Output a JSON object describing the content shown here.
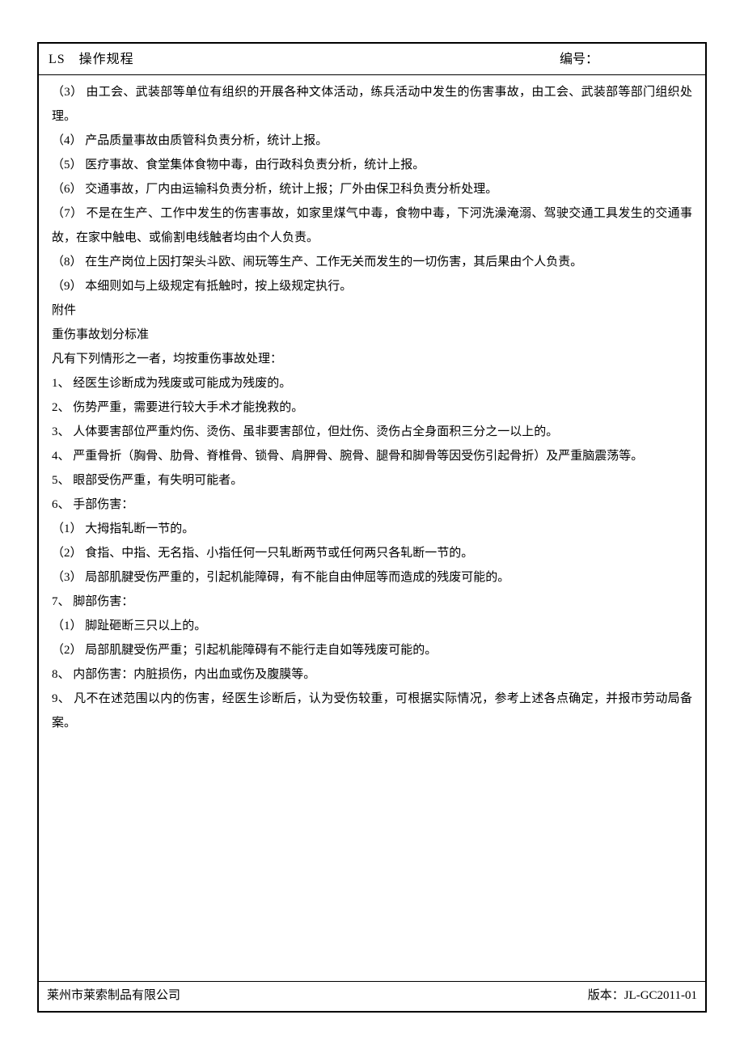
{
  "header": {
    "left": "LS　操作规程",
    "right": "编号："
  },
  "paragraphs": [
    "（3） 由工会、武装部等单位有组织的开展各种文体活动，练兵活动中发生的伤害事故，由工会、武装部等部门组织处理。",
    "（4） 产品质量事故由质管科负责分析，统计上报。",
    "（5） 医疗事故、食堂集体食物中毒，由行政科负责分析，统计上报。",
    "（6） 交通事故，厂内由运输科负责分析，统计上报；厂外由保卫科负责分析处理。",
    "（7） 不是在生产、工作中发生的伤害事故，如家里煤气中毒，食物中毒，下河洗澡淹溺、驾驶交通工具发生的交通事故，在家中触电、或偷割电线触者均由个人负责。",
    "（8） 在生产岗位上因打架头斗欧、闹玩等生产、工作无关而发生的一切伤害，其后果由个人负责。",
    "（9） 本细则如与上级规定有抵触时，按上级规定执行。",
    "附件",
    "重伤事故划分标准",
    "凡有下列情形之一者，均按重伤事故处理：",
    "1、 经医生诊断成为残废或可能成为残废的。",
    "2、 伤势严重，需要进行较大手术才能挽救的。",
    "3、 人体要害部位严重灼伤、烫伤、虽非要害部位，但灶伤、烫伤占全身面积三分之一以上的。",
    "4、 严重骨折（胸骨、肋骨、脊椎骨、锁骨、肩胛骨、腕骨、腿骨和脚骨等因受伤引起骨折）及严重脑震荡等。",
    "5、 眼部受伤严重，有失明可能者。",
    "6、 手部伤害：",
    "（1） 大拇指轧断一节的。",
    "（2） 食指、中指、无名指、小指任何一只轧断两节或任何两只各轧断一节的。",
    "（3） 局部肌腱受伤严重的，引起机能障碍，有不能自由伸屈等而造成的残废可能的。",
    "7、 脚部伤害：",
    "（1） 脚趾砸断三只以上的。",
    "（2） 局部肌腱受伤严重；引起机能障碍有不能行走自如等残废可能的。",
    "8、 内部伤害：内脏损伤，内出血或伤及腹膜等。",
    "9、 凡不在述范围以内的伤害，经医生诊断后，认为受伤较重，可根据实际情况，参考上述各点确定，并报市劳动局备案。"
  ],
  "footer": {
    "left": "莱州市莱索制品有限公司",
    "right": "版本：JL-GC2011-01"
  }
}
